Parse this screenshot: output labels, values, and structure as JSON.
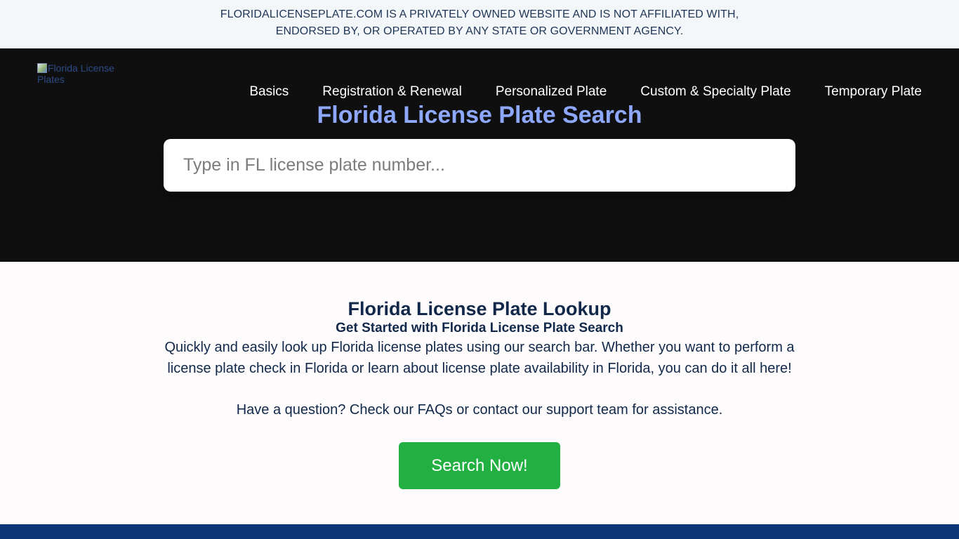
{
  "disclaimer": {
    "line1": "FLORIDALICENSEPLATE.COM IS A PRIVATELY OWNED WEBSITE AND IS NOT AFFILIATED WITH,",
    "line2": "ENDORSED BY, OR OPERATED BY ANY STATE OR GOVERNMENT AGENCY."
  },
  "header": {
    "logo_alt": "Florida License Plates",
    "nav": [
      {
        "label": "Basics"
      },
      {
        "label": "Registration & Renewal"
      },
      {
        "label": "Personalized Plate"
      },
      {
        "label": "Custom & Specialty Plate"
      },
      {
        "label": "Temporary Plate"
      }
    ]
  },
  "hero": {
    "title": "Florida License Plate Search",
    "search_placeholder": "Type in FL license plate number...",
    "search_value": ""
  },
  "main": {
    "title": "Florida License Plate Lookup",
    "subtitle": "Get Started with Florida License Plate Search",
    "description": "Quickly and easily look up Florida license plates using our search bar. Whether you want to perform a license plate check in Florida or learn about license plate availability in Florida, you can do it all here!",
    "help_text": "Have a question? Check our FAQs or contact our support team for assistance.",
    "cta_label": "Search Now!"
  },
  "colors": {
    "disclaimer_bg": "#f3f7fa",
    "hero_bg": "#0f0f0f",
    "hero_title": "#8fa8ff",
    "text_navy": "#12284a",
    "cta_green": "#22b043",
    "footer_band": "#0b3577"
  }
}
